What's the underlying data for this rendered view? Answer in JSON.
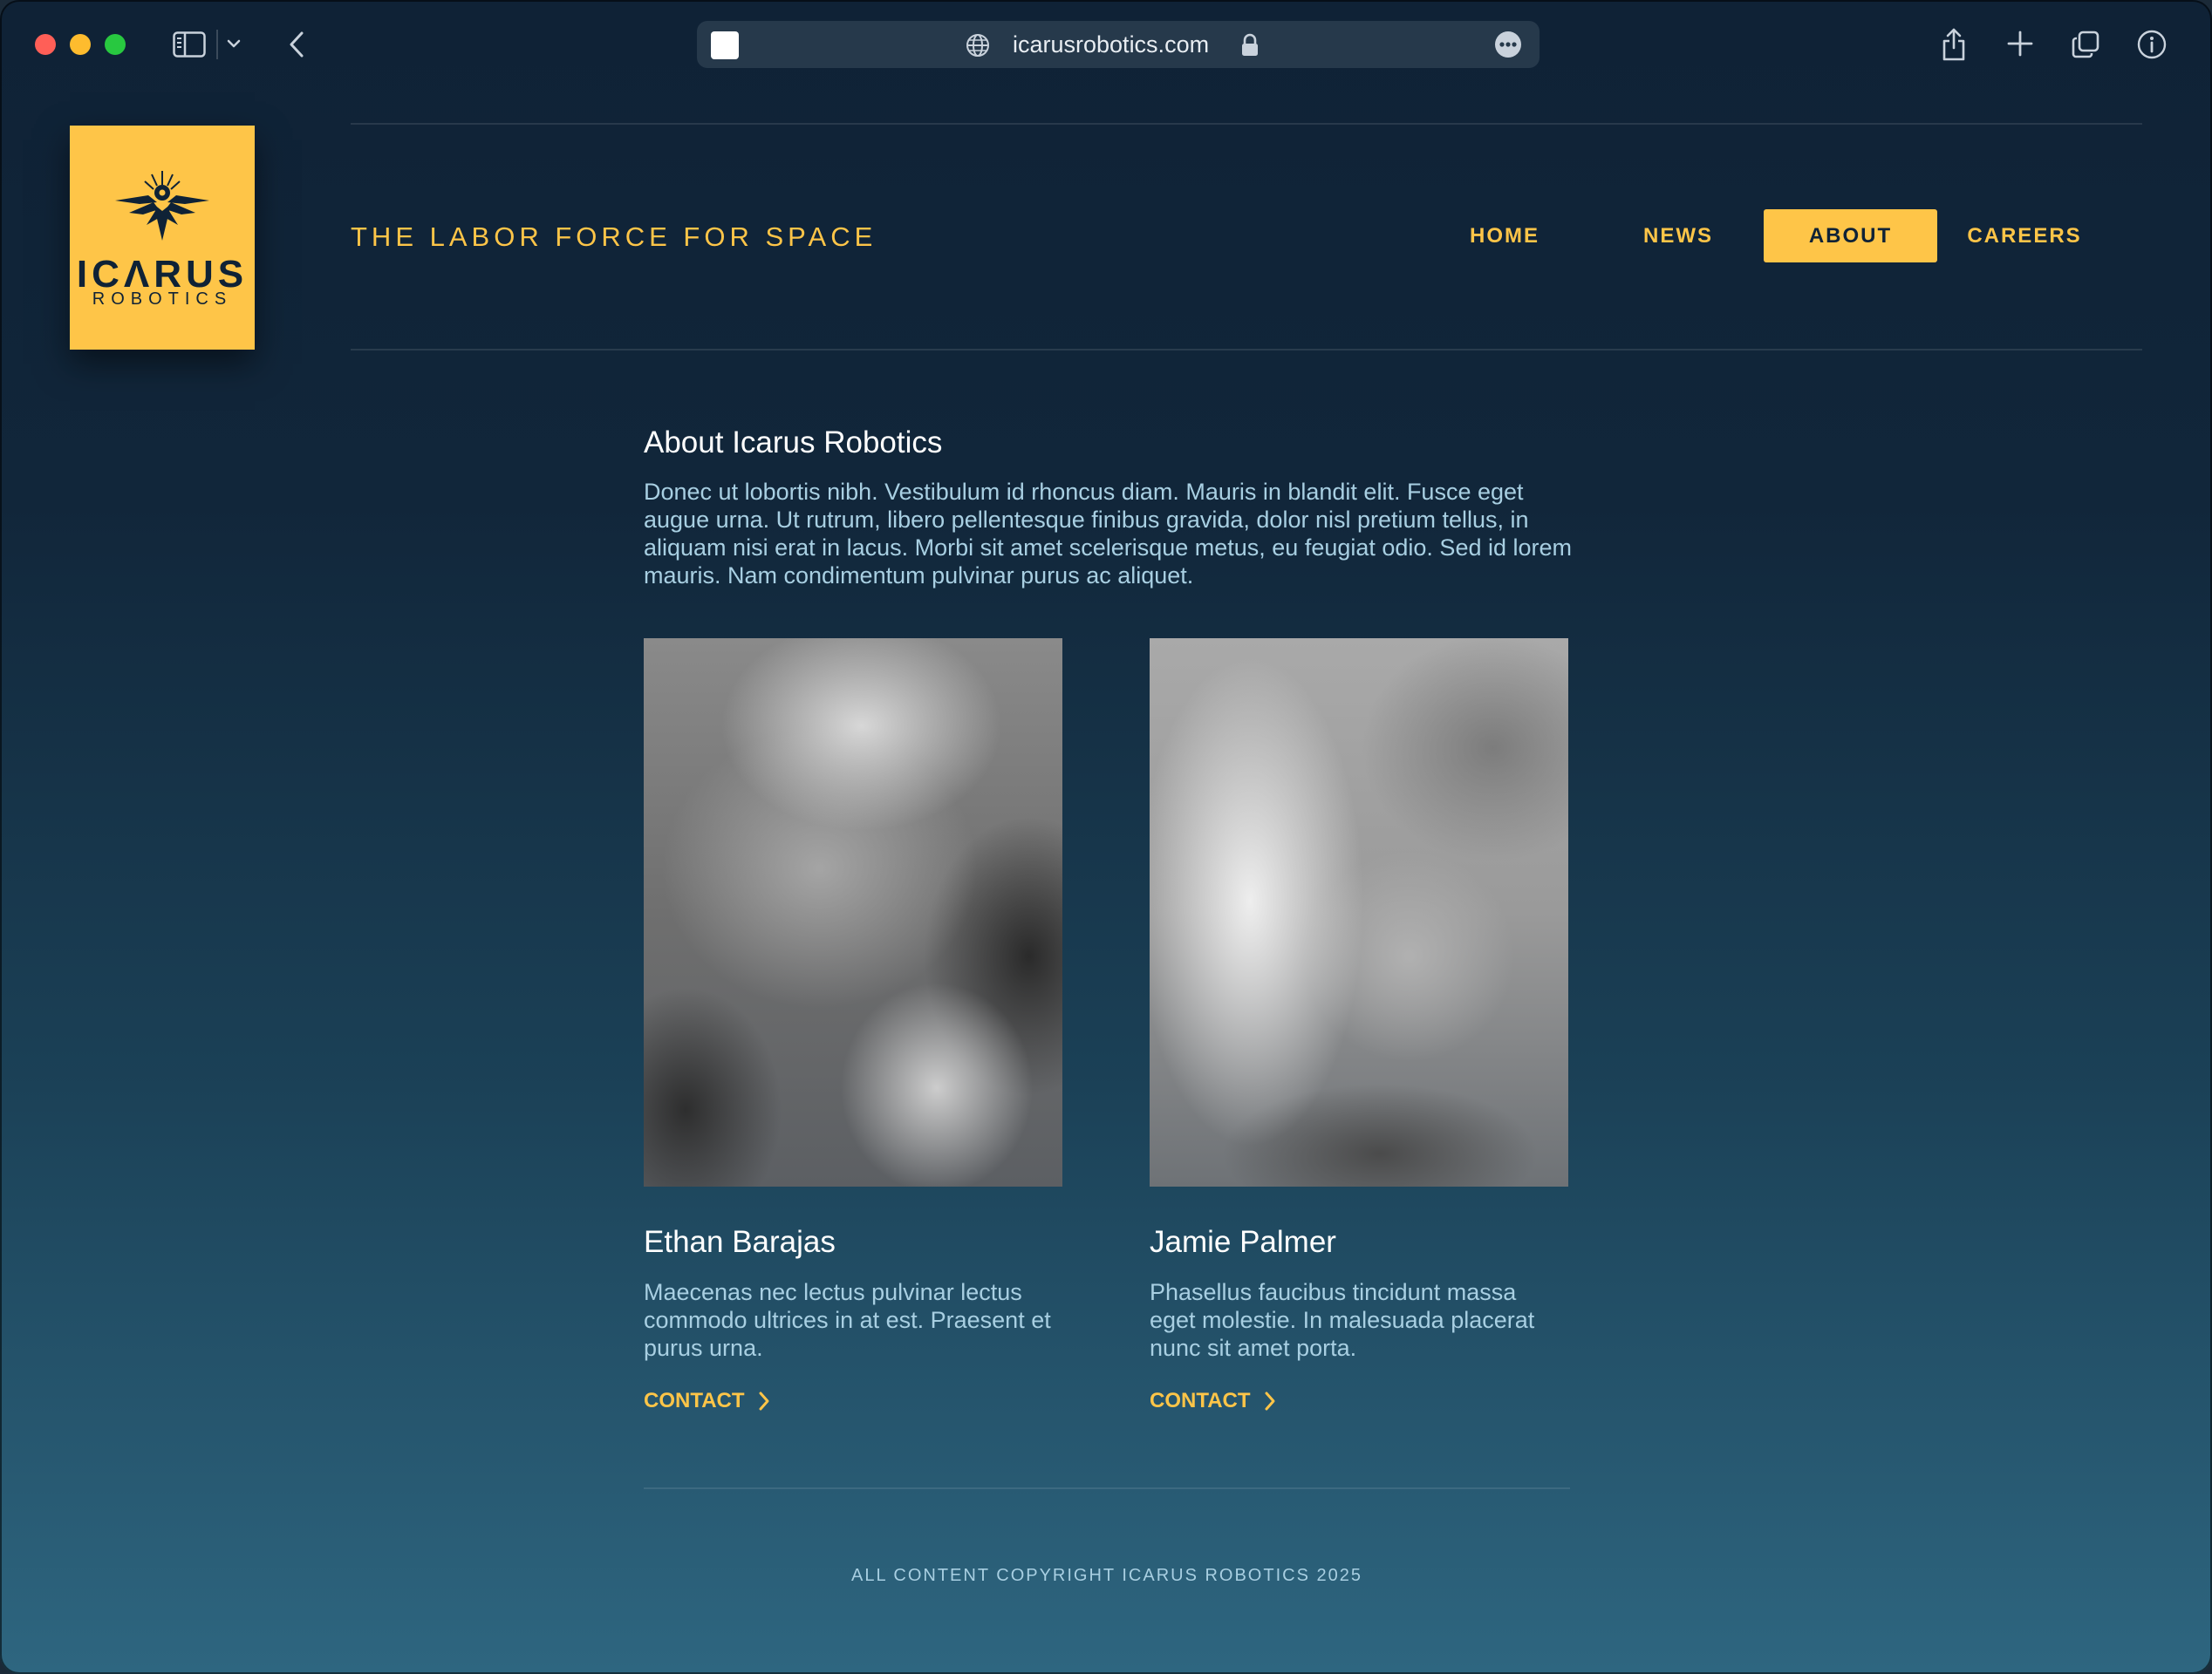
{
  "browser": {
    "url": "icarusrobotics.com",
    "icons": [
      "sidebar-icon",
      "chevron-down-icon",
      "back-icon",
      "globe-icon",
      "lock-icon",
      "more-icon",
      "share-icon",
      "plus-icon",
      "tabs-icon",
      "info-icon"
    ]
  },
  "logo": {
    "line1": "ICΛRUS",
    "line2": "ROBOTICS"
  },
  "header": {
    "tagline": "THE LABOR FORCE FOR SPACE"
  },
  "nav": {
    "home": "HOME",
    "news": "NEWS",
    "about": "ABOUT",
    "careers": "CAREERS",
    "active": "ABOUT"
  },
  "about": {
    "title": "About Icarus Robotics",
    "body": "Donec ut lobortis nibh. Vestibulum id rhoncus diam. Mauris in blandit elit. Fusce eget augue urna. Ut rutrum, libero pellentesque finibus gravida, dolor nisl pretium tellus, in aliquam nisi erat in lacus. Morbi sit amet scelerisque metus, eu feugiat odio. Sed id lorem mauris. Nam condimentum pulvinar purus ac aliquet."
  },
  "team": [
    {
      "name": "Ethan Barajas",
      "bio": "Maecenas nec lectus pulvinar lectus commodo ultrices in at est. Praesent et purus urna.",
      "contact": "CONTACT"
    },
    {
      "name": "Jamie Palmer",
      "bio": "Phasellus faucibus tincidunt massa eget molestie. In malesuada placerat nunc sit amet porta.",
      "contact": "CONTACT"
    }
  ],
  "footer": {
    "copyright": "ALL CONTENT COPYRIGHT ICARUS ROBOTICS 2025"
  },
  "colors": {
    "accent": "#fec548",
    "text_muted": "#a8cfe2",
    "bg_top": "#0f2236",
    "bg_bottom": "#2e6680"
  }
}
